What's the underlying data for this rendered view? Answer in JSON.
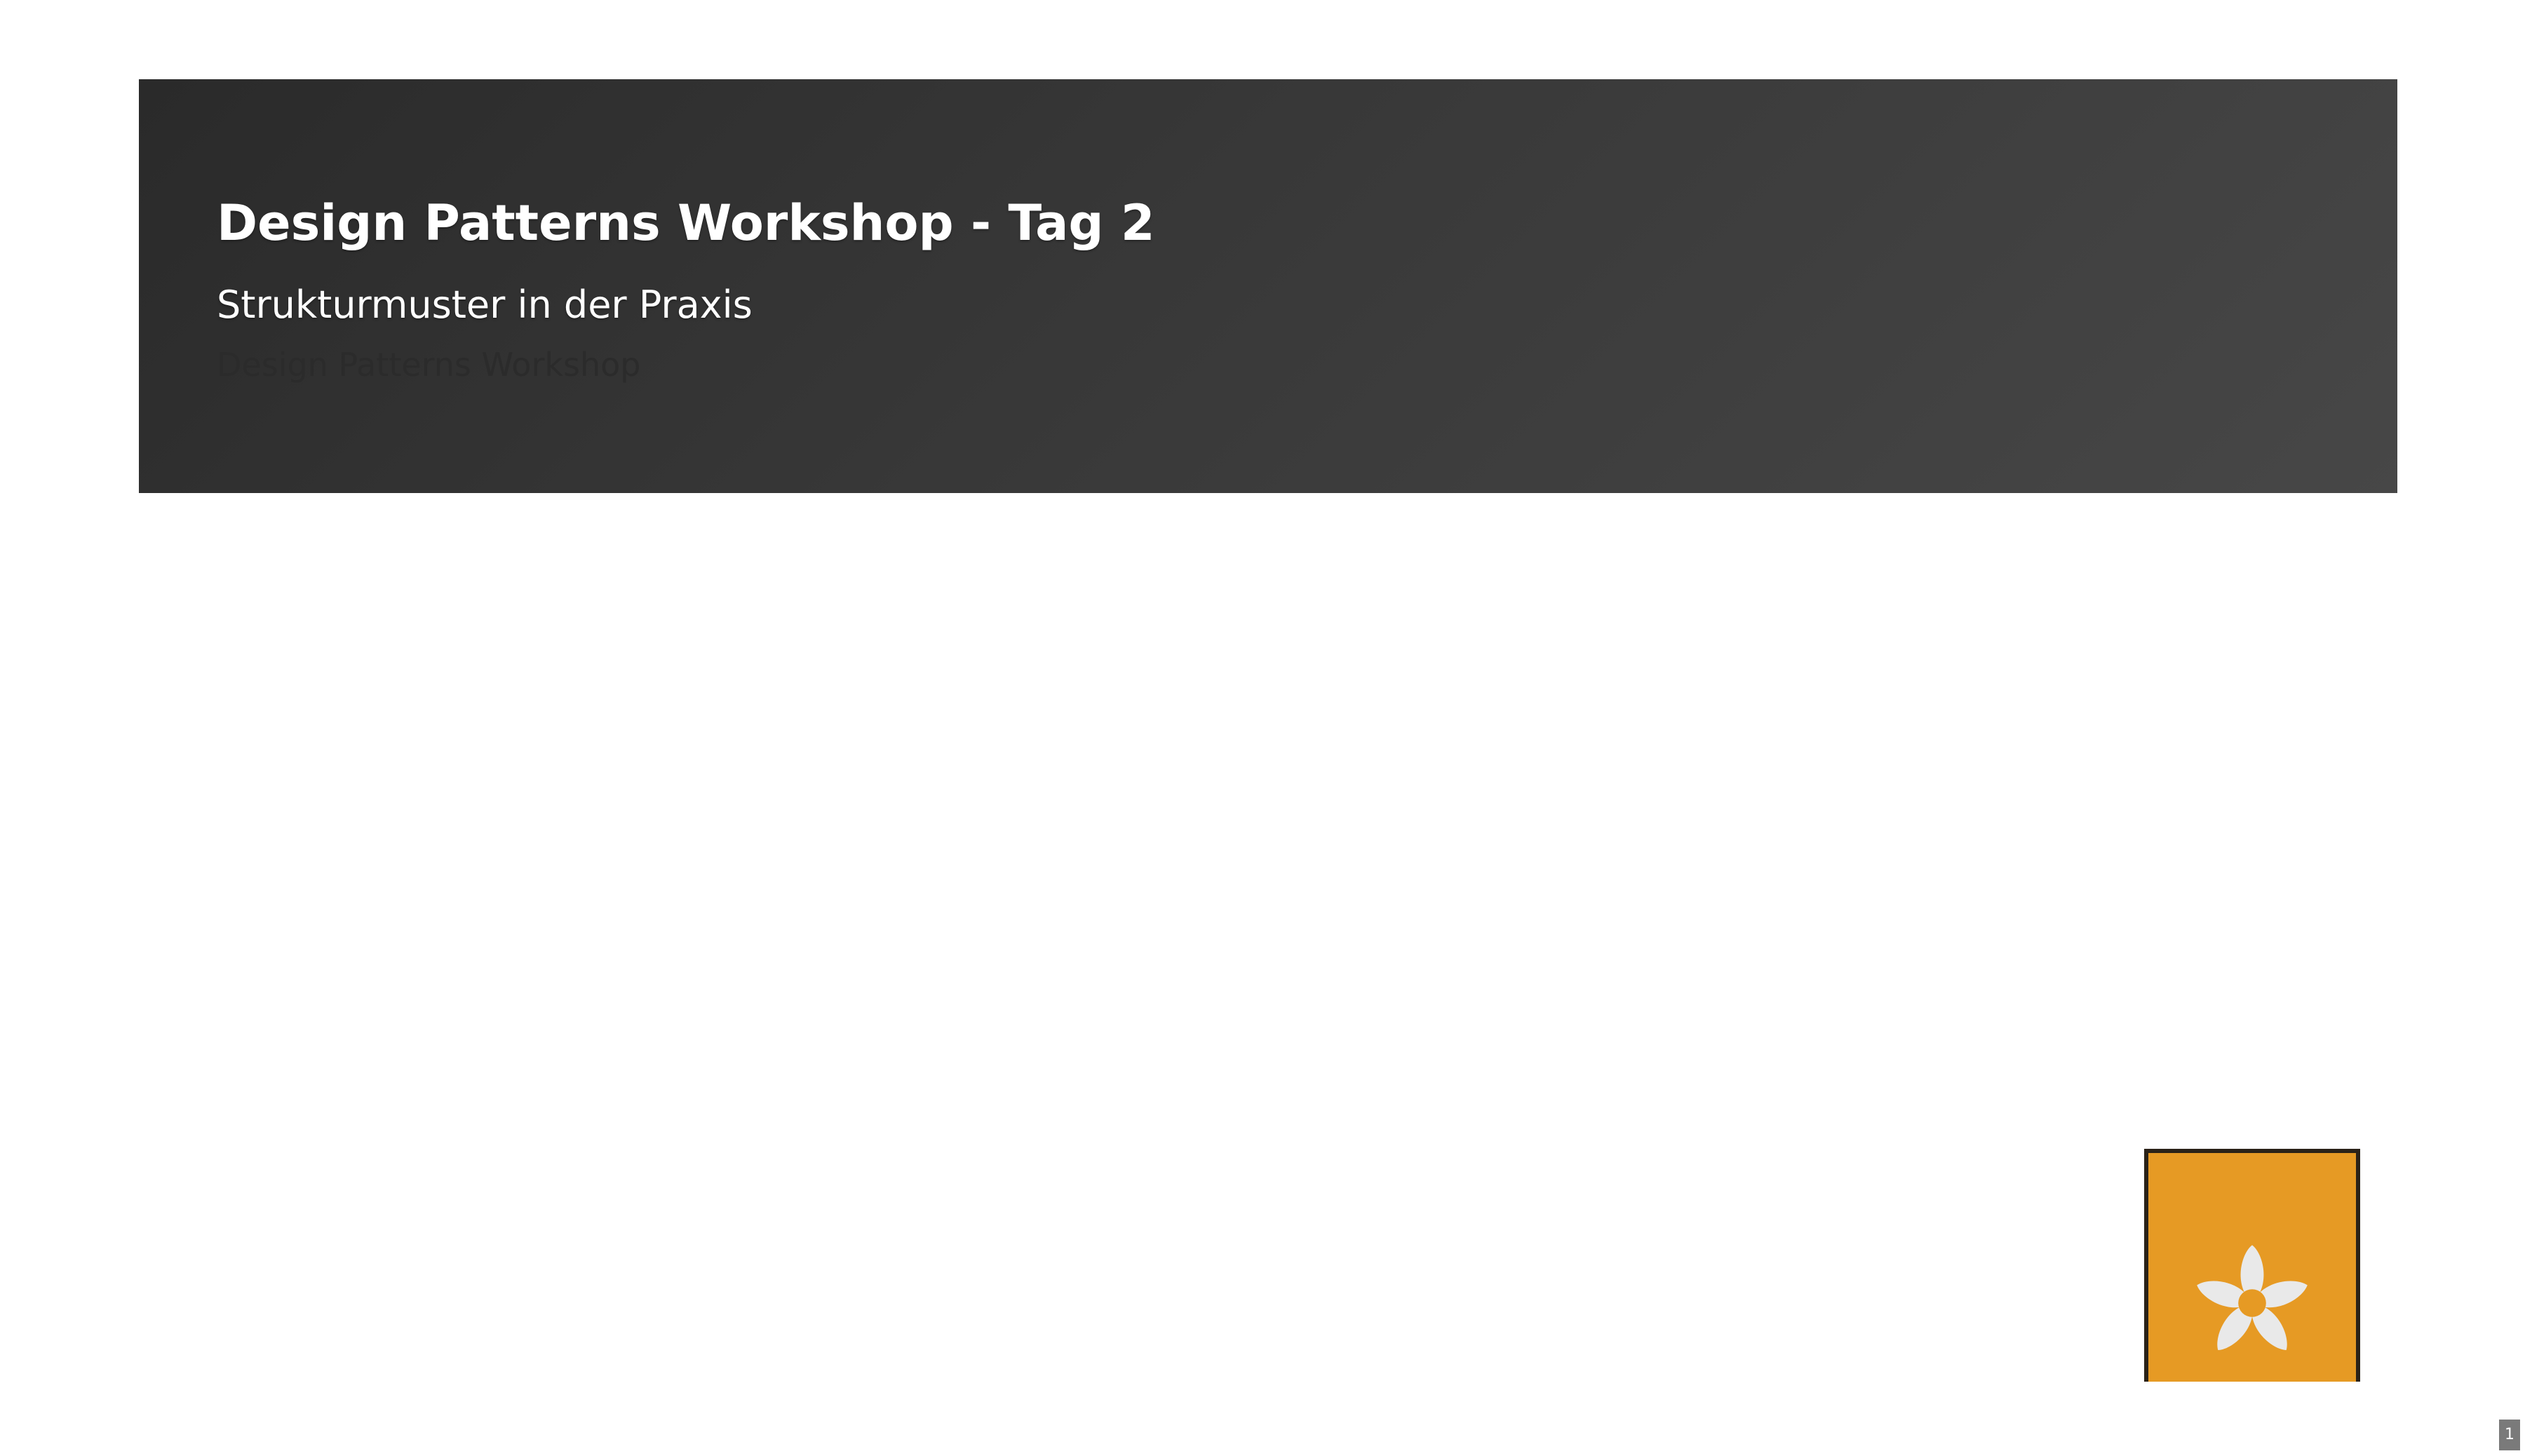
{
  "slide": {
    "title": "Design Patterns Workshop - Tag 2",
    "subtitle": "Strukturmuster in der Praxis",
    "caption": "Design Patterns Workshop",
    "page_number": "1"
  },
  "logo": {
    "icon": "flower-icon",
    "background_color": "#e69a24",
    "petal_color": "#e9e9e9"
  },
  "colors": {
    "banner_dark": "#2a2a2a",
    "banner_light": "#474747",
    "title_text": "#ffffff",
    "caption_text": "#2b2b2b"
  }
}
